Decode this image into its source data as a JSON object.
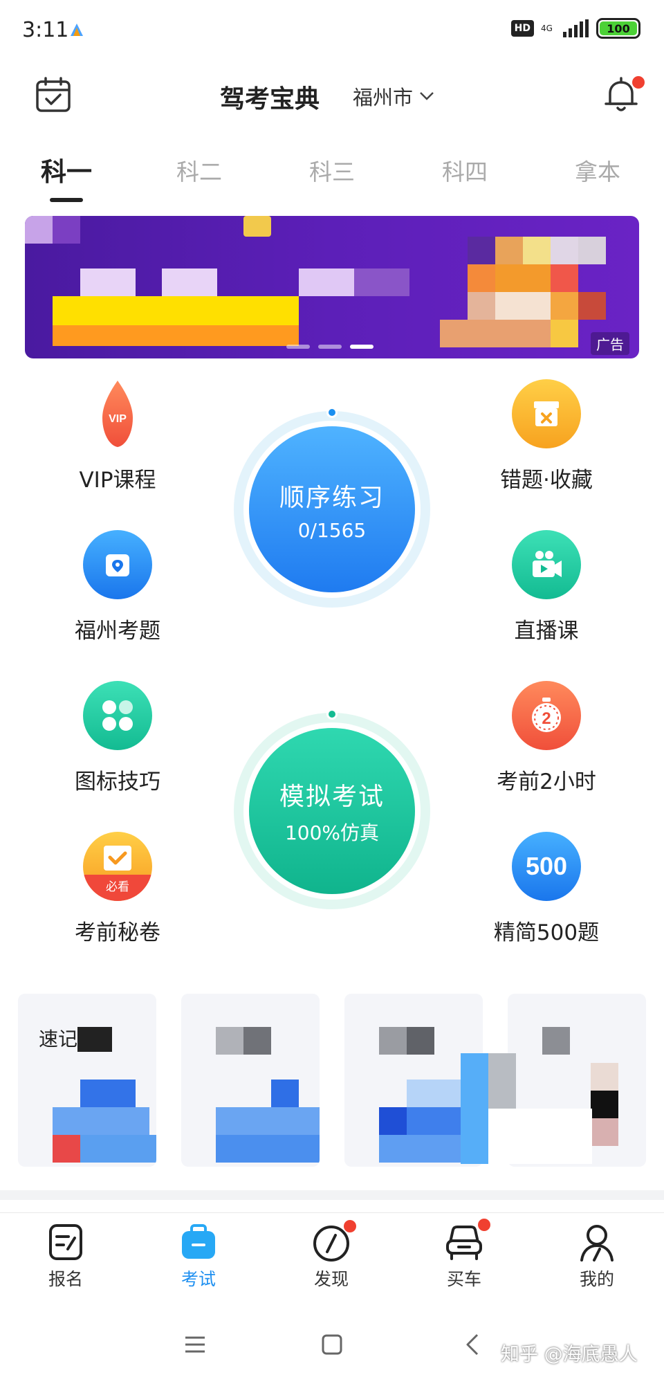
{
  "status_bar": {
    "time": "3:11",
    "hd": "HD",
    "network": "4G",
    "battery": "100"
  },
  "header": {
    "title": "驾考宝典",
    "city": "福州市"
  },
  "tabs": [
    {
      "label": "科一",
      "active": true
    },
    {
      "label": "科二",
      "active": false
    },
    {
      "label": "科三",
      "active": false
    },
    {
      "label": "科四",
      "active": false
    },
    {
      "label": "拿本",
      "active": false
    }
  ],
  "banner": {
    "ad_label": "广告",
    "dots": 3,
    "active_dot": 2
  },
  "features": {
    "vip": {
      "label": "VIP课程",
      "icon": "vip-icon",
      "badge": "VIP"
    },
    "mistakes": {
      "label": "错题·收藏",
      "icon": "mistake-box-icon"
    },
    "local": {
      "label": "福州考题",
      "icon": "location-icon"
    },
    "live": {
      "label": "直播课",
      "icon": "video-camera-icon"
    },
    "signs": {
      "label": "图标技巧",
      "icon": "grid-icon"
    },
    "two_hours": {
      "label": "考前2小时",
      "icon": "stopwatch-icon",
      "badge": "2"
    },
    "secret": {
      "label": "考前秘卷",
      "icon": "must-see-icon",
      "badge": "必看"
    },
    "simplified": {
      "label": "精简500题",
      "icon": "500-icon",
      "badge": "500"
    }
  },
  "practice": {
    "title": "顺序练习",
    "progress": "0/1565",
    "done": 0,
    "total": 1565
  },
  "mock_exam": {
    "title": "模拟考试",
    "subtitle": "100%仿真"
  },
  "cards": [
    {
      "title": "速记"
    },
    {
      "title": ""
    },
    {
      "title": ""
    },
    {
      "title": ""
    }
  ],
  "bottom_nav": [
    {
      "label": "报名",
      "icon": "signup-icon",
      "active": false,
      "dot": false
    },
    {
      "label": "考试",
      "icon": "exam-bag-icon",
      "active": true,
      "dot": false
    },
    {
      "label": "发现",
      "icon": "compass-icon",
      "active": false,
      "dot": true
    },
    {
      "label": "买车",
      "icon": "car-icon",
      "active": false,
      "dot": true
    },
    {
      "label": "我的",
      "icon": "profile-icon",
      "active": false,
      "dot": false
    }
  ],
  "watermark": "知乎 @海底愚人",
  "colors": {
    "accent_blue": "#1e8ff0",
    "accent_green": "#17c39b",
    "notify_red": "#f04030",
    "banner_purple": "#5c1fb8"
  }
}
